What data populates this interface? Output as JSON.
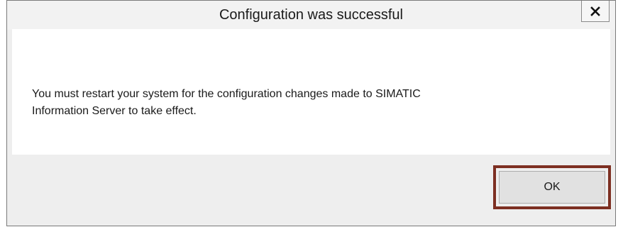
{
  "dialog": {
    "title": "Configuration was successful",
    "message_line1": "You must restart your system for the configuration changes made to SIMATIC",
    "message_line2": "Information Server to take effect.",
    "ok_label": "OK",
    "close_icon": "close-icon"
  },
  "colors": {
    "highlight_border": "#7d2f22",
    "dialog_background": "#eeeeee",
    "content_background": "#ffffff"
  }
}
